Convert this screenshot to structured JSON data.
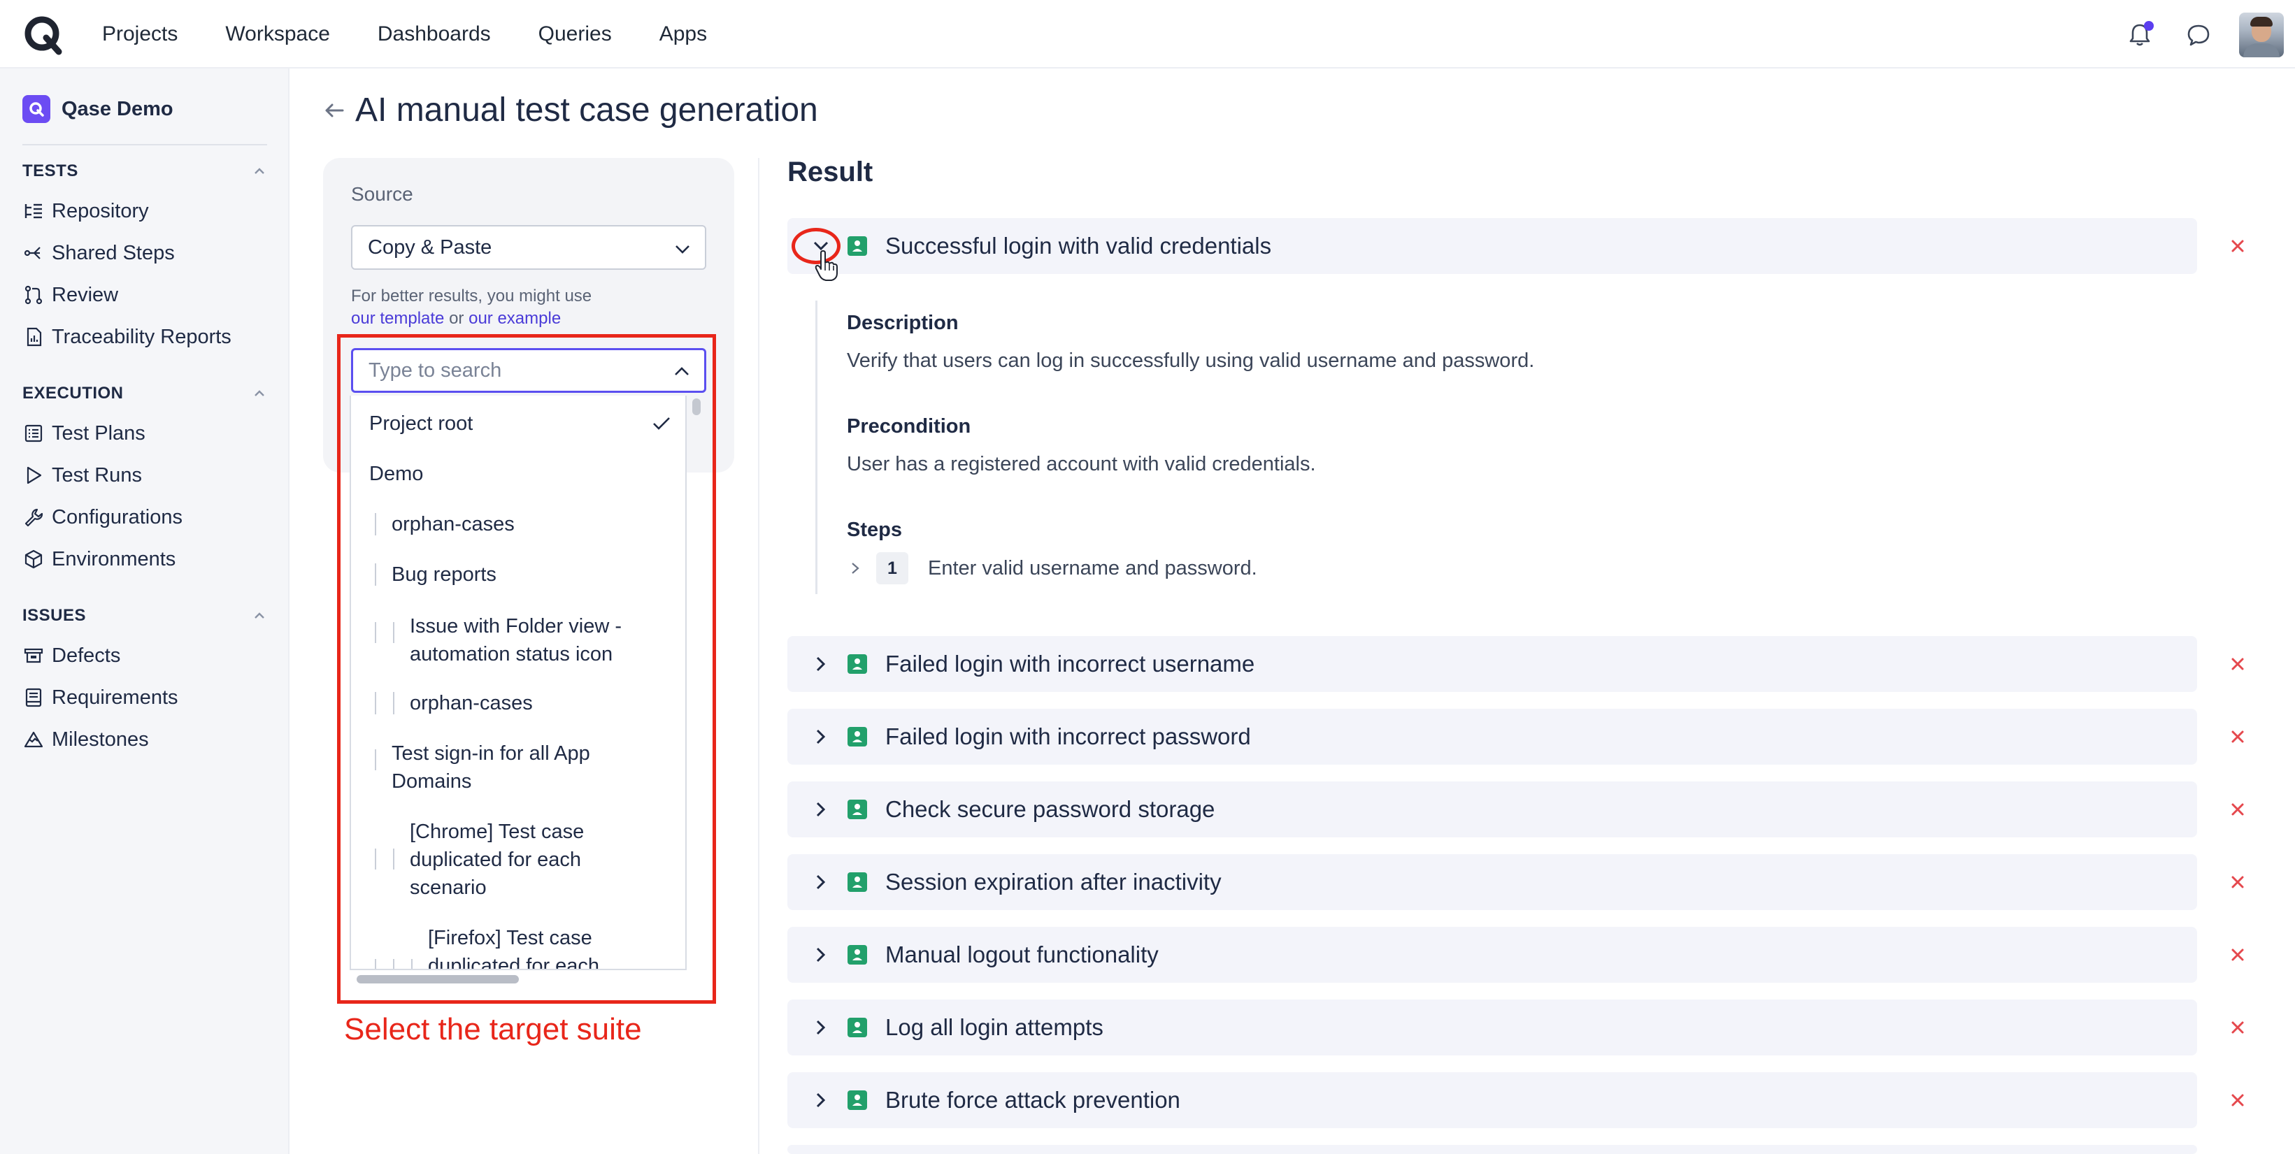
{
  "nav": {
    "links": [
      "Projects",
      "Workspace",
      "Dashboards",
      "Queries",
      "Apps"
    ]
  },
  "sidebar": {
    "project": "Qase Demo",
    "sections": [
      {
        "title": "TESTS",
        "items": [
          "Repository",
          "Shared Steps",
          "Review",
          "Traceability Reports"
        ]
      },
      {
        "title": "EXECUTION",
        "items": [
          "Test Plans",
          "Test Runs",
          "Configurations",
          "Environments"
        ]
      },
      {
        "title": "ISSUES",
        "items": [
          "Defects",
          "Requirements",
          "Milestones"
        ]
      }
    ]
  },
  "page": {
    "title": "AI manual test case generation"
  },
  "source": {
    "label": "Source",
    "selected": "Copy & Paste",
    "hint_prefix": "For better results, you might use",
    "hint_link1": "our template",
    "hint_or": " or ",
    "hint_link2": "our example"
  },
  "suite_search": {
    "placeholder": "Type to search",
    "items": [
      {
        "label": "Project root",
        "selected": true
      },
      {
        "label": "Demo"
      },
      {
        "label": "orphan-cases"
      },
      {
        "label": "Bug reports"
      },
      {
        "label": "Issue with Folder view - automation status icon"
      },
      {
        "label": "orphan-cases"
      },
      {
        "label": "Test sign-in for all App Domains"
      },
      {
        "label": "[Chrome] Test case duplicated for each scenario"
      },
      {
        "label": "[Firefox] Test case duplicated for each"
      }
    ]
  },
  "annotation": {
    "text": "Select the target suite"
  },
  "result": {
    "heading": "Result",
    "cases": [
      "Successful login with valid credentials",
      "Failed login with incorrect username",
      "Failed login with incorrect password",
      "Check secure password storage",
      "Session expiration after inactivity",
      "Manual logout functionality",
      "Log all login attempts",
      "Brute force attack prevention"
    ],
    "expanded": {
      "description_label": "Description",
      "description": "Verify that users can log in successfully using valid username and password.",
      "precondition_label": "Precondition",
      "precondition": "User has a registered account with valid credentials.",
      "steps_label": "Steps",
      "steps": [
        {
          "num": "1",
          "text": "Enter valid username and password."
        }
      ]
    }
  },
  "colors": {
    "accent": "#5b4ff0",
    "annotation_red": "#e8261a",
    "case_icon": "#22a06b",
    "delete": "#e5484d"
  }
}
